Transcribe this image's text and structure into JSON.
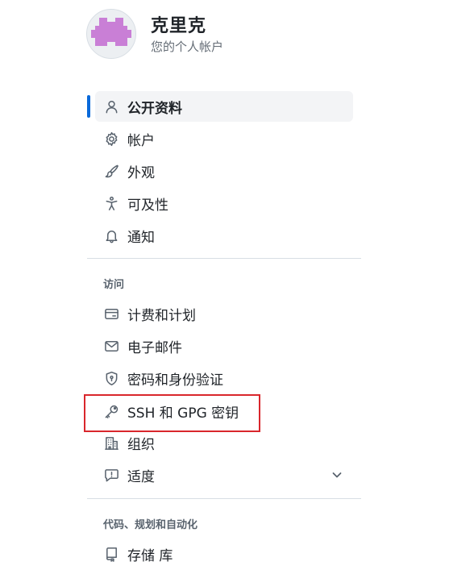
{
  "account": {
    "name": "克里克",
    "subtitle": "您的个人帐户",
    "avatar_color": "#c97fd6"
  },
  "nav": {
    "items_top": [
      {
        "label": "公开资料",
        "icon": "person-icon",
        "active": true
      },
      {
        "label": "帐户",
        "icon": "gear-icon"
      },
      {
        "label": "外观",
        "icon": "paintbrush-icon"
      },
      {
        "label": "可及性",
        "icon": "accessibility-icon"
      },
      {
        "label": "通知",
        "icon": "bell-icon"
      }
    ],
    "section_access": {
      "heading": "访问",
      "items": [
        {
          "label": "计费和计划",
          "icon": "credit-card-icon"
        },
        {
          "label": "电子邮件",
          "icon": "mail-icon"
        },
        {
          "label": "密码和身份验证",
          "icon": "shield-lock-icon"
        },
        {
          "label": "SSH 和 GPG 密钥",
          "icon": "key-icon",
          "highlighted": true
        },
        {
          "label": "组织",
          "icon": "organization-icon"
        },
        {
          "label": "适度",
          "icon": "report-icon",
          "expandable": true
        }
      ]
    },
    "section_code": {
      "heading": "代码、规划和自动化",
      "items": [
        {
          "label": "存储 库",
          "icon": "repo-icon"
        }
      ]
    }
  },
  "colors": {
    "accent": "#0969da",
    "highlight": "#d9262c",
    "active_bg": "#f3f4f6"
  }
}
